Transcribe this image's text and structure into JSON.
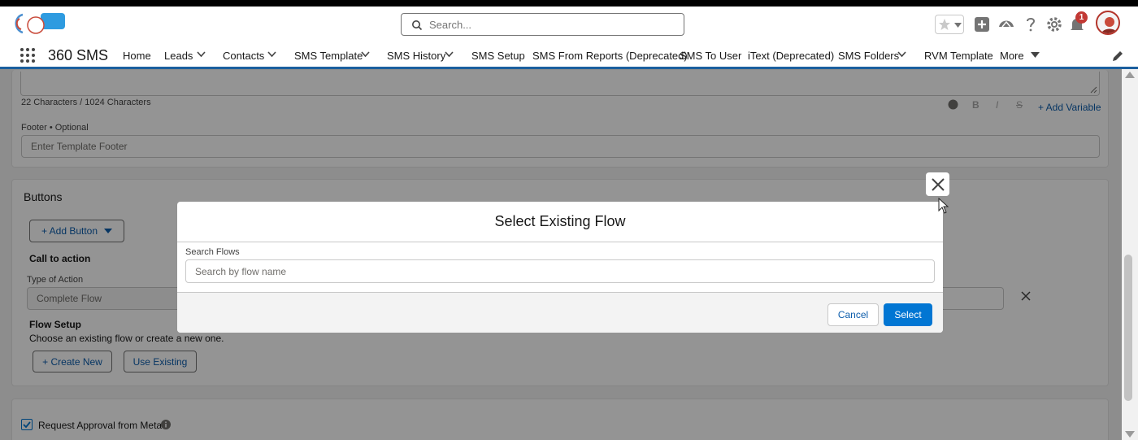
{
  "header": {
    "search_placeholder": "Search...",
    "notification_count": "1"
  },
  "nav": {
    "app_name": "360 SMS",
    "items": [
      {
        "label": "Home"
      },
      {
        "label": "Leads"
      },
      {
        "label": "Contacts"
      },
      {
        "label": "SMS Template"
      },
      {
        "label": "SMS History"
      },
      {
        "label": "SMS Setup"
      },
      {
        "label": "SMS From Reports (Deprecated)"
      },
      {
        "label": "SMS To User"
      },
      {
        "label": "iText (Deprecated)"
      },
      {
        "label": "SMS Folders"
      },
      {
        "label": "RVM Template"
      },
      {
        "label": "More"
      }
    ]
  },
  "body": {
    "char_count": "22 Characters / 1024 Characters",
    "add_variable": "+ Add Variable",
    "footer_label": "Footer • Optional",
    "footer_placeholder": "Enter Template Footer",
    "buttons_title": "Buttons",
    "add_button": "+ Add Button",
    "cta_title": "Call to action",
    "type_label": "Type of Action",
    "type_value": "Complete Flow",
    "flow_setup_title": "Flow Setup",
    "flow_setup_desc": "Choose an existing flow or create a new one.",
    "create_new": "+ Create New",
    "use_existing": "Use Existing",
    "request_approval": "Request Approval from Meta"
  },
  "modal": {
    "title": "Select Existing Flow",
    "search_label": "Search Flows",
    "search_placeholder": "Search by flow name",
    "cancel": "Cancel",
    "select": "Select"
  },
  "colors": {
    "brand_blue": "#0176d3",
    "nav_underline": "#1b5f9e",
    "badge_red": "#c23934"
  }
}
